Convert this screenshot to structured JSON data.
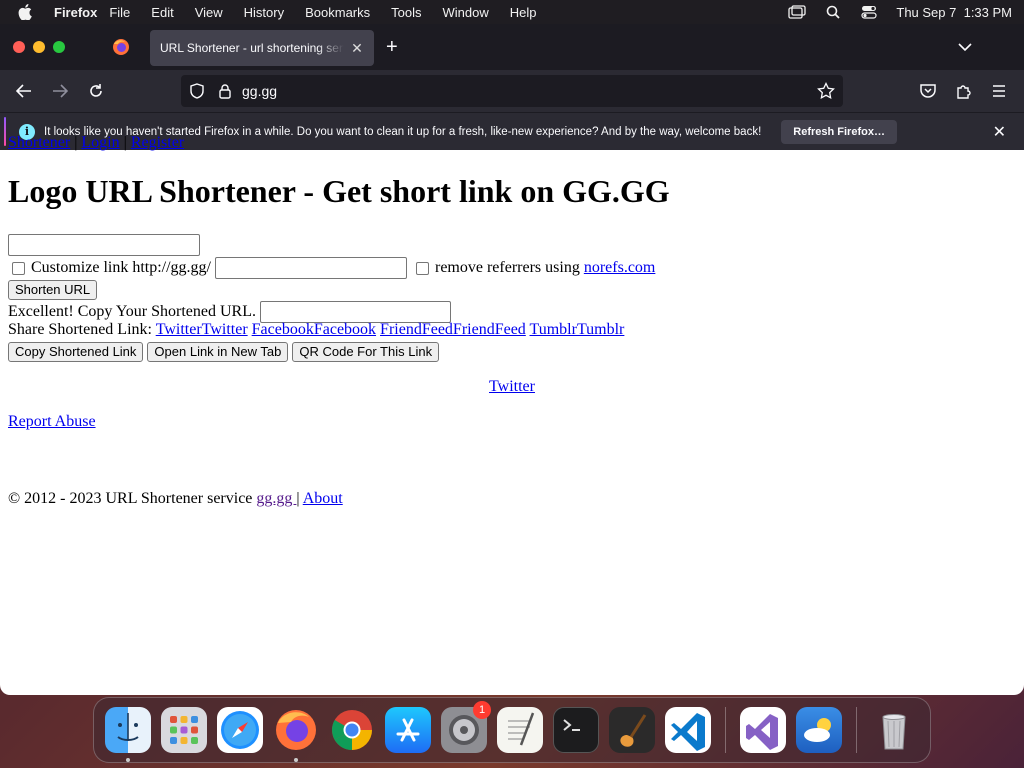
{
  "menubar": {
    "app_name": "Firefox",
    "items": [
      "File",
      "Edit",
      "View",
      "History",
      "Bookmarks",
      "Tools",
      "Window",
      "Help"
    ],
    "clock": "Thu Sep 7  1:33 PM"
  },
  "browser": {
    "tab_title": "URL Shortener - url shortening service",
    "url": "gg.gg",
    "notification": {
      "message": "It looks like you haven't started Firefox in a while. Do you want to clean it up for a fresh, like-new experience? And by the way, welcome back!",
      "button": "Refresh Firefox…"
    }
  },
  "page": {
    "nav": {
      "shortener": "Shortener",
      "sep1": " | ",
      "login": "Login",
      "sep2": " | ",
      "register": "Register"
    },
    "title": "Logo URL Shortener - Get short link on GG.GG",
    "long_url_value": "",
    "customize_label": "Customize link http://gg.gg/",
    "custom_value": "",
    "remove_ref_label": "remove referrers using ",
    "norefs_link": "norefs.com",
    "shorten_button": "Shorten URL",
    "result_label": "Excellent! Copy Your Shortened URL. ",
    "result_value": "",
    "share_label": "Share Shortened Link: ",
    "share_links": [
      "TwitterTwitter",
      "FacebookFacebook",
      "FriendFeedFriendFeed",
      "TumblrTumblr"
    ],
    "buttons": {
      "copy": "Copy Shortened Link",
      "open": "Open Link in New Tab",
      "qr": "QR Code For This Link"
    },
    "twitter_link": "Twitter",
    "report_abuse": "Report Abuse",
    "footer": {
      "text": "© 2012 - 2023 URL Shortener service ",
      "gg_link": "gg.gg ",
      "sep": "| ",
      "about": "About"
    }
  },
  "dock": {
    "apps": [
      "finder",
      "launchpad",
      "safari",
      "firefox",
      "chrome",
      "app-store",
      "system-settings",
      "textedit",
      "terminal",
      "garageband",
      "vscode",
      "visual-studio",
      "weather",
      "trash"
    ],
    "system_settings_badge": "1"
  }
}
